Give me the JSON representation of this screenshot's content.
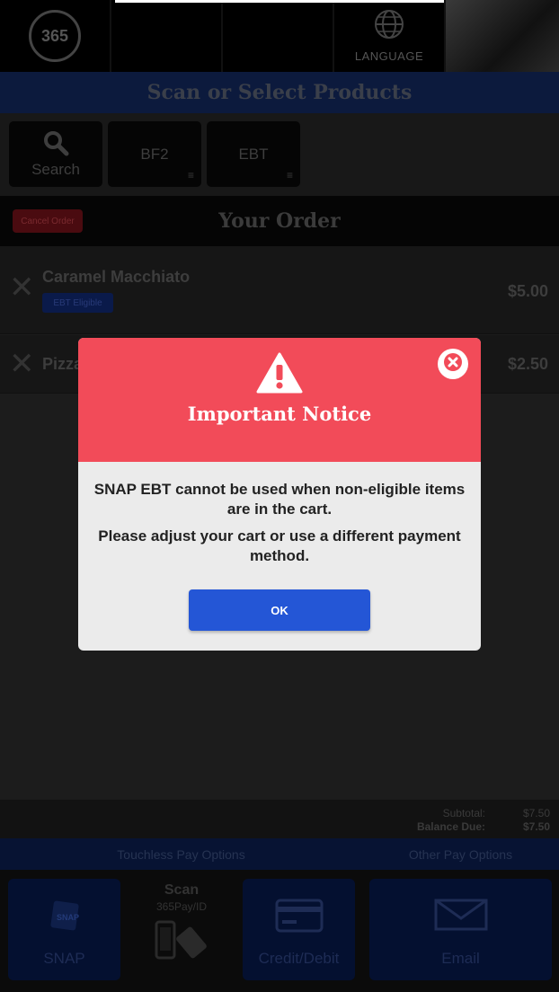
{
  "header": {
    "logo_text": "365",
    "language_label": "LANGUAGE",
    "banner_title": "Scan or Select Products"
  },
  "categories": [
    {
      "label": "Search",
      "icon": "search-icon"
    },
    {
      "label": "BF2",
      "icon": "menu-lines-icon"
    },
    {
      "label": "EBT",
      "icon": "menu-lines-icon"
    }
  ],
  "order": {
    "cancel_label": "Cancel Order",
    "title": "Your Order",
    "items": [
      {
        "name": "Caramel Macchiato",
        "price": "$5.00",
        "badge": "EBT Eligible"
      },
      {
        "name": "Pizza",
        "price": "$2.50"
      }
    ]
  },
  "totals": {
    "subtotal_label": "Subtotal:",
    "subtotal_value": "$7.50",
    "balance_label": "Balance Due:",
    "balance_value": "$7.50"
  },
  "pay": {
    "touchless_label": "Touchless Pay Options",
    "other_label": "Other Pay Options",
    "snap_label": "SNAP",
    "scan_title": "Scan",
    "scan_sub": "365Pay/ID",
    "credit_label": "Credit/Debit",
    "email_label": "Email"
  },
  "modal": {
    "title": "Important Notice",
    "message_1": "SNAP EBT cannot be used when non-eligible items are in the cart.",
    "message_2": "Please adjust your cart or use a different payment method.",
    "ok_label": "OK",
    "header_color": "#f24b59",
    "button_color": "#2456d6"
  }
}
